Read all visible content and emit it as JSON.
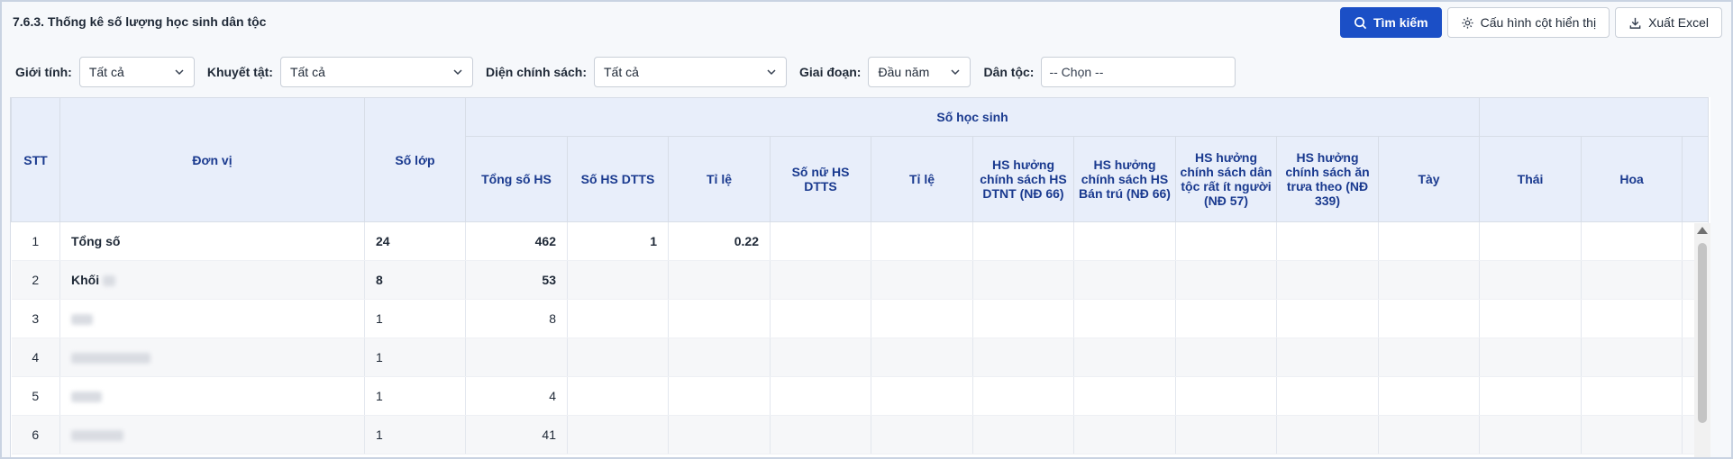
{
  "title": "7.6.3. Thống kê số lượng học sinh dân tộc",
  "toolbar": {
    "search_label": "Tìm kiếm",
    "config_label": "Cấu hình cột hiển thị",
    "export_label": "Xuất Excel"
  },
  "filters": {
    "gender_label": "Giới tính:",
    "gender_value": "Tất cả",
    "disability_label": "Khuyết tật:",
    "disability_value": "Tất cả",
    "policy_label": "Diện chính sách:",
    "policy_value": "Tất cả",
    "period_label": "Giai đoạn:",
    "period_value": "Đầu năm",
    "ethnic_label": "Dân tộc:",
    "ethnic_placeholder": "-- Chọn --"
  },
  "table": {
    "headers": {
      "stt": "STT",
      "unit": "Đơn vị",
      "classes": "Số lớp",
      "students_group": "Số học sinh",
      "total": "Tổng số HS",
      "dtts": "Số HS DTTS",
      "ratio1": "Tỉ lệ",
      "female_dtts": "Số nữ HS DTTS",
      "ratio2": "Tỉ lệ",
      "policy_dtnt": "HS hưởng chính sách HS DTNT (NĐ 66)",
      "policy_bantru": "HS hưởng chính sách HS Bán trú (NĐ 66)",
      "policy_minority": "HS hưởng chính sách dân tộc rất ít người (NĐ 57)",
      "policy_lunch": "HS hưởng chính sách ăn trưa theo (NĐ 339)",
      "tay": "Tày",
      "thai": "Thái",
      "hoa": "Hoa"
    },
    "rows": [
      {
        "stt": "1",
        "unit": "Tổng số",
        "classes": "24",
        "total": "462",
        "dtts": "1",
        "ratio": "0.22"
      },
      {
        "stt": "2",
        "unit": "Khối",
        "classes": "8",
        "total": "53",
        "dtts": "",
        "ratio": ""
      },
      {
        "stt": "3",
        "unit": "",
        "classes": "1",
        "total": "8",
        "dtts": "",
        "ratio": ""
      },
      {
        "stt": "4",
        "unit": "",
        "classes": "1",
        "total": "",
        "dtts": "",
        "ratio": ""
      },
      {
        "stt": "5",
        "unit": "",
        "classes": "1",
        "total": "4",
        "dtts": "",
        "ratio": ""
      },
      {
        "stt": "6",
        "unit": "",
        "classes": "1",
        "total": "41",
        "dtts": "",
        "ratio": ""
      }
    ]
  }
}
